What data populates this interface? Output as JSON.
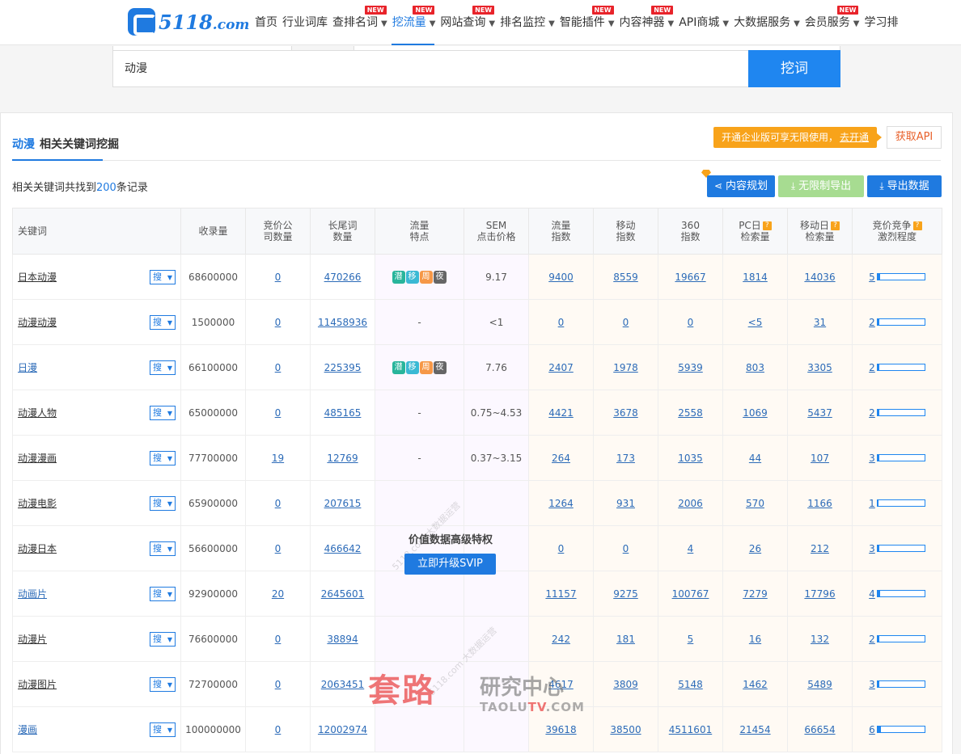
{
  "header": {
    "logo_text": "5118",
    "logo_suffix": ".com",
    "nav": [
      {
        "label": "首页",
        "caret": false,
        "badge": ""
      },
      {
        "label": "行业词库",
        "caret": false,
        "badge": ""
      },
      {
        "label": "查排名词",
        "caret": true,
        "badge": "NEW"
      },
      {
        "label": "挖流量",
        "caret": true,
        "badge": "NEW",
        "active": true
      },
      {
        "label": "网站查询",
        "caret": true,
        "badge": "NEW"
      },
      {
        "label": "排名监控",
        "caret": true,
        "badge": ""
      },
      {
        "label": "智能插件",
        "caret": true,
        "badge": "NEW"
      },
      {
        "label": "内容神器",
        "caret": true,
        "badge": "NEW"
      },
      {
        "label": "API商城",
        "caret": true,
        "badge": ""
      },
      {
        "label": "大数据服务",
        "caret": true,
        "badge": ""
      },
      {
        "label": "会员服务",
        "caret": true,
        "badge": "NEW"
      },
      {
        "label": "学习排",
        "caret": false,
        "badge": ""
      }
    ]
  },
  "search": {
    "value": "动漫",
    "button": "挖词"
  },
  "section": {
    "keyword": "动漫",
    "title": "相关关键词挖掘",
    "promo_text": "开通企业版可享无限使用，",
    "promo_link": "去开通",
    "api_button": "获取API",
    "record_prefix": "相关关键词共找到",
    "record_count": "200",
    "record_suffix": "条记录",
    "btn_plan": "内容规划",
    "btn_unlimited": "无限制导出",
    "btn_export": "导出数据"
  },
  "table": {
    "headers": {
      "keyword": "关键词",
      "index_count": "收录量",
      "bid_companies_1": "竞价公",
      "bid_companies_2": "司数量",
      "long_tail_1": "长尾词",
      "long_tail_2": "数量",
      "traffic_feat_1": "流量",
      "traffic_feat_2": "特点",
      "sem_1": "SEM",
      "sem_2": "点击价格",
      "traffic_idx_1": "流量",
      "traffic_idx_2": "指数",
      "mobile_idx_1": "移动",
      "mobile_idx_2": "指数",
      "idx360_1": "360",
      "idx360_2": "指数",
      "pc_daily_1": "PC日",
      "pc_daily_2": "检索量",
      "mobile_daily_1": "移动日",
      "mobile_daily_2": "检索量",
      "competition_1": "竞价竞争",
      "competition_2": "激烈程度",
      "help": "?"
    },
    "search_btn": "搜",
    "tag_labels": [
      "潜",
      "移",
      "周",
      "夜"
    ],
    "rows": [
      {
        "kw": "日本动漫",
        "kw_blue": false,
        "index": "68600000",
        "bid": "0",
        "long": "470266",
        "tags": true,
        "sem": "9.17",
        "flow": "9400",
        "mobile": "8559",
        "i360": "19667",
        "pc": "1814",
        "mday": "14036",
        "comp": "5",
        "comp_pct": 6
      },
      {
        "kw": "动漫动漫",
        "kw_blue": false,
        "index": "1500000",
        "bid": "0",
        "long": "11458936",
        "tags": false,
        "feat": "-",
        "sem": "<1",
        "flow": "0",
        "mobile": "0",
        "i360": "0",
        "pc": "<5",
        "mday": "31",
        "comp": "2",
        "comp_pct": 3
      },
      {
        "kw": "日漫",
        "kw_blue": true,
        "index": "66100000",
        "bid": "0",
        "long": "225395",
        "tags": true,
        "sem": "7.76",
        "flow": "2407",
        "mobile": "1978",
        "i360": "5939",
        "pc": "803",
        "mday": "3305",
        "comp": "2",
        "comp_pct": 3
      },
      {
        "kw": "动漫人物",
        "kw_blue": false,
        "index": "65000000",
        "bid": "0",
        "long": "485165",
        "tags": false,
        "feat": "-",
        "sem": "0.75~4.53",
        "flow": "4421",
        "mobile": "3678",
        "i360": "2558",
        "pc": "1069",
        "mday": "5437",
        "comp": "2",
        "comp_pct": 3
      },
      {
        "kw": "动漫漫画",
        "kw_blue": false,
        "index": "77700000",
        "bid": "19",
        "long": "12769",
        "tags": false,
        "feat": "-",
        "sem": "0.37~3.15",
        "flow": "264",
        "mobile": "173",
        "i360": "1035",
        "pc": "44",
        "mday": "107",
        "comp": "3",
        "comp_pct": 4
      },
      {
        "kw": "动漫电影",
        "kw_blue": false,
        "index": "65900000",
        "bid": "0",
        "long": "207615",
        "tags": false,
        "feat": "",
        "sem": "",
        "flow": "1264",
        "mobile": "931",
        "i360": "2006",
        "pc": "570",
        "mday": "1166",
        "comp": "1",
        "comp_pct": 2
      },
      {
        "kw": "动漫日本",
        "kw_blue": false,
        "index": "56600000",
        "bid": "0",
        "long": "466642",
        "tags": false,
        "feat": "",
        "sem": "",
        "flow": "0",
        "mobile": "0",
        "i360": "4",
        "pc": "26",
        "mday": "212",
        "comp": "3",
        "comp_pct": 4
      },
      {
        "kw": "动画片",
        "kw_blue": true,
        "index": "92900000",
        "bid": "20",
        "long": "2645601",
        "tags": false,
        "feat": "",
        "sem": "",
        "flow": "11157",
        "mobile": "9275",
        "i360": "100767",
        "pc": "7279",
        "mday": "17796",
        "comp": "4",
        "comp_pct": 5
      },
      {
        "kw": "动漫片",
        "kw_blue": false,
        "index": "76600000",
        "bid": "0",
        "long": "38894",
        "tags": false,
        "feat": "",
        "sem": "",
        "flow": "242",
        "mobile": "181",
        "i360": "5",
        "pc": "16",
        "mday": "132",
        "comp": "2",
        "comp_pct": 3
      },
      {
        "kw": "动漫图片",
        "kw_blue": false,
        "index": "72700000",
        "bid": "0",
        "long": "2063451",
        "tags": false,
        "feat": "",
        "sem": "",
        "flow": "4617",
        "mobile": "3809",
        "i360": "5148",
        "pc": "1462",
        "mday": "5489",
        "comp": "3",
        "comp_pct": 4
      },
      {
        "kw": "漫画",
        "kw_blue": true,
        "index": "100000000",
        "bid": "0",
        "long": "12002974",
        "tags": false,
        "feat": "",
        "sem": "",
        "flow": "39618",
        "mobile": "38500",
        "i360": "4511601",
        "pc": "21454",
        "mday": "66654",
        "comp": "6",
        "comp_pct": 8
      }
    ]
  },
  "overlay": {
    "title": "价值数据高级特权",
    "button": "立即升级SVIP",
    "diag_wm": "5118.com 大数据运营",
    "brand_big": "套路",
    "brand_mid": "研究中心",
    "brand_sub_a": "TAOLU",
    "brand_sub_b": "TV",
    "brand_sub_c": ".COM"
  },
  "colors": {
    "accent": "#1f7ae0",
    "promo": "#f8a31a",
    "unlimited": "#a7dc91",
    "badge": "#e8232a"
  }
}
